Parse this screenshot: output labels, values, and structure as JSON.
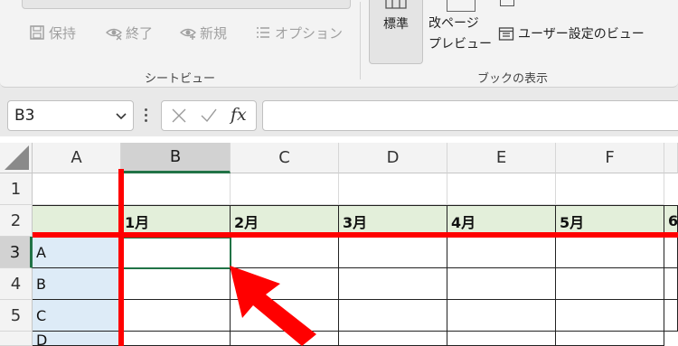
{
  "ribbon": {
    "sheet_view_group": {
      "label": "シートビュー",
      "buttons": [
        {
          "label": "保持",
          "icon": "save-icon"
        },
        {
          "label": "終了",
          "icon": "eye-close-icon"
        },
        {
          "label": "新規",
          "icon": "eye-new-icon"
        },
        {
          "label": "オプション",
          "icon": "list-options-icon"
        }
      ]
    },
    "workbook_view_group": {
      "label": "ブックの表示",
      "standard_label": "標準",
      "page_break_line1": "改ページ",
      "page_break_line2": "プレビュー",
      "custom_view_label": "ユーザー設定のビュー"
    }
  },
  "formula_bar": {
    "name_box": "B3",
    "fx_label": "fx",
    "formula": ""
  },
  "sheet": {
    "columns": [
      "A",
      "B",
      "C",
      "D",
      "E",
      "F"
    ],
    "rows": [
      "1",
      "2",
      "3",
      "4",
      "5"
    ],
    "months": [
      "1月",
      "2月",
      "3月",
      "4月",
      "5月",
      "6"
    ],
    "labels": [
      "A",
      "B",
      "C",
      "D"
    ],
    "active_cell": "B3"
  },
  "colors": {
    "freeze_line": "#ff0000",
    "header_fill": "#e3efda",
    "label_fill": "#ddebf7",
    "selection": "#217346"
  }
}
